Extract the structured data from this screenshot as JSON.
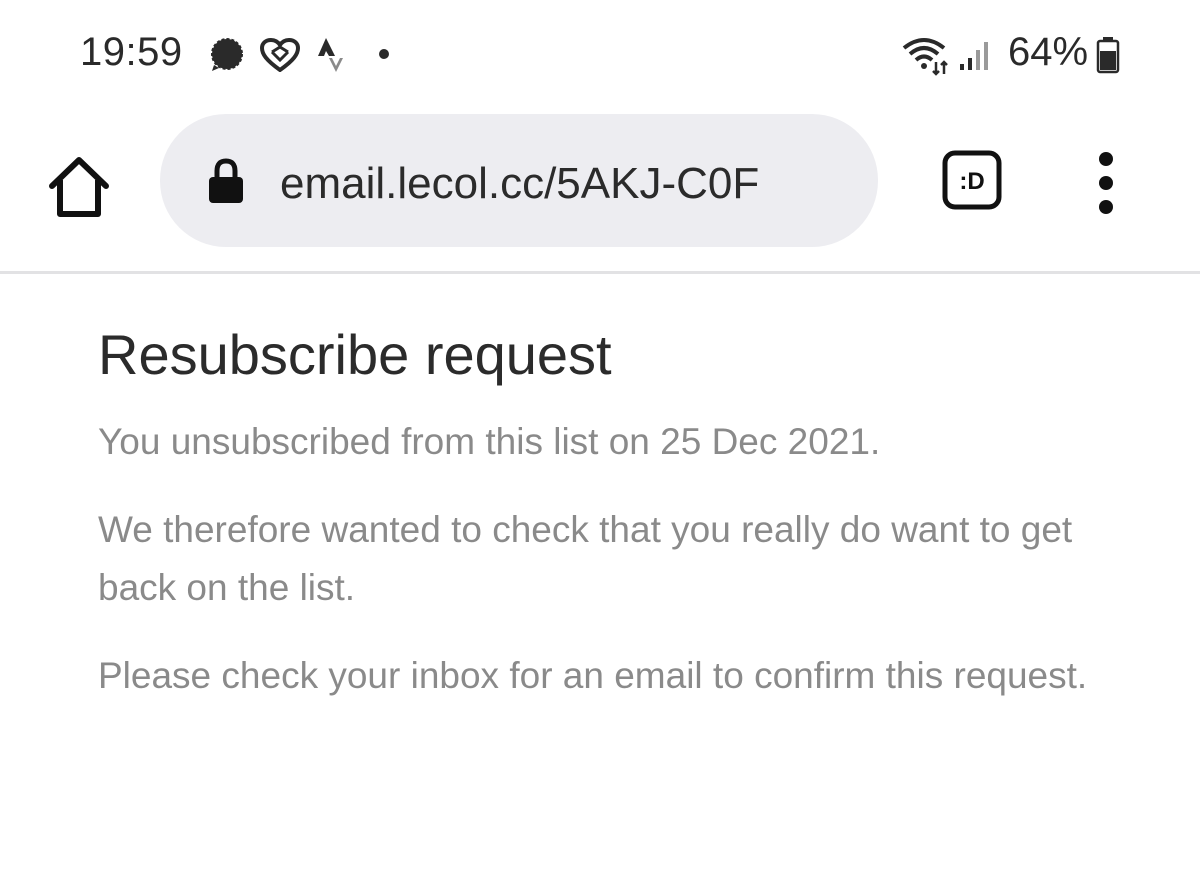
{
  "status_bar": {
    "time": "19:59",
    "battery_percent": "64%",
    "left_icons": [
      "signal-messenger-icon",
      "heart-icon",
      "strava-icon",
      "dot-icon"
    ],
    "right_icons": [
      "wifi-icon",
      "cell-signal-icon",
      "battery-icon"
    ]
  },
  "browser": {
    "url": "email.lecol.cc/5AKJ-C0F",
    "extension_label": ":D"
  },
  "page": {
    "title": "Resubscribe request",
    "paragraphs": [
      "You unsubscribed from this list on 25 Dec 2021.",
      "We therefore wanted to check that you really do want to get back on the list.",
      "Please check your inbox for an email to confirm this request."
    ]
  },
  "colors": {
    "url_bar_bg": "#ededf1",
    "title_text": "#2b2b2b",
    "body_text": "#8a8a8a"
  }
}
